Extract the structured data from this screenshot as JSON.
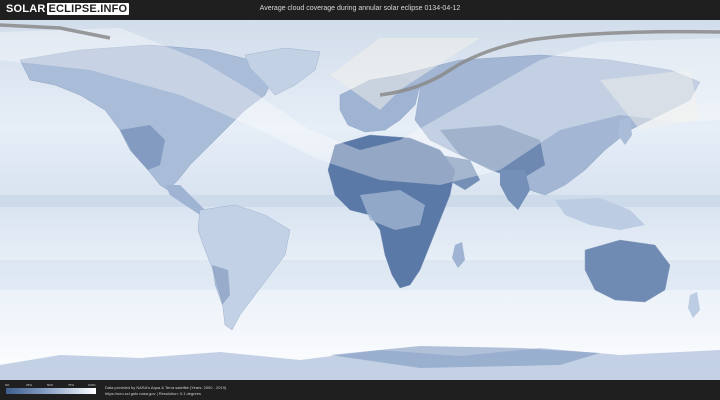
{
  "header": {
    "logo_left": "SOLAR",
    "logo_box": "ECLIPSE.INFO",
    "title": "Average cloud coverage during annular solar eclipse 0134-04-12"
  },
  "legend": {
    "scale_labels": [
      "0%",
      "25%",
      "50%",
      "75%",
      "100%"
    ],
    "colors": {
      "clear": "#3f5e8c",
      "cloudy": "#ffffff"
    }
  },
  "credits": {
    "line1": "Data provided by NASA's Aqua & Terra satellite (Years: 2000 - 2019)",
    "line2": "https://neo.sci.gsfc.nasa.gov | Resolution: 0.1 degrees"
  },
  "map": {
    "colors": {
      "ocean_cloud": "#e4ecf5",
      "land_low_cloud": "#4e6c98",
      "land_mid_cloud": "#8aa3c7",
      "shadow_region": "#ffffff",
      "central_line": "#8a8a8a"
    }
  }
}
